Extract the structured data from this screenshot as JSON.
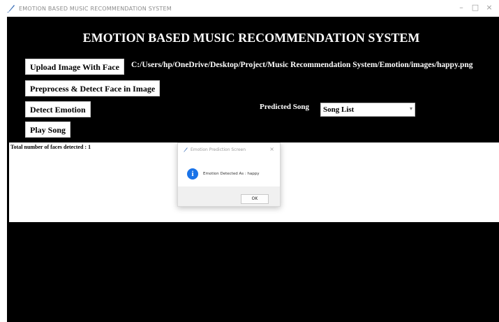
{
  "window": {
    "title": "EMOTION BASED MUSIC RECOMMENDATION SYSTEM",
    "minimize_glyph": "–",
    "maximize_glyph": "□",
    "close_glyph": "×",
    "icon": "feather-icon"
  },
  "app": {
    "heading": "EMOTION BASED MUSIC RECOMMENDATION SYSTEM",
    "buttons": {
      "upload": "Upload Image With Face",
      "preprocess": "Preprocess & Detect Face in Image",
      "detect": "Detect Emotion",
      "play": "Play Song"
    },
    "image_path": "C:/Users/hp/OneDrive/Desktop/Project/Music Recommendation System/Emotion/images/happy.png",
    "predicted_song_label": "Predicted Song",
    "song_combo_value": "Song List",
    "output_text": "Total number of faces detected : 1"
  },
  "dialog": {
    "title": "Emotion Prediction Screen",
    "message": "Emotion Detected As : happy",
    "ok_label": "OK",
    "close_glyph": "×",
    "icon": "info-icon",
    "info_glyph": "i"
  },
  "colors": {
    "background": "#000000",
    "text_on_dark": "#ffffff",
    "info_blue": "#1a73e8"
  }
}
